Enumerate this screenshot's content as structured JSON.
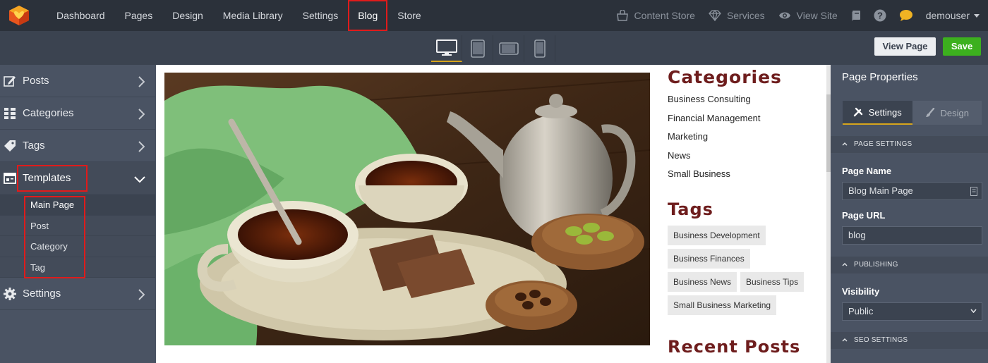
{
  "nav": {
    "items": [
      "Dashboard",
      "Pages",
      "Design",
      "Media Library",
      "Settings",
      "Blog",
      "Store"
    ],
    "active": "Blog",
    "right": {
      "content_store": "Content Store",
      "services": "Services",
      "view_site": "View Site",
      "user": "demouser"
    }
  },
  "toolbar": {
    "devices": [
      "desktop-icon",
      "tablet-icon",
      "tablet-landscape-icon",
      "phone-icon"
    ],
    "active_device": "desktop-icon",
    "view_page": "View Page",
    "save": "Save"
  },
  "sidebar": {
    "items": [
      {
        "label": "Posts",
        "icon": "edit-icon"
      },
      {
        "label": "Categories",
        "icon": "grid-icon"
      },
      {
        "label": "Tags",
        "icon": "tag-icon"
      },
      {
        "label": "Templates",
        "icon": "template-icon"
      },
      {
        "label": "Settings",
        "icon": "gear-icon"
      }
    ],
    "templates_sub": [
      "Main Page",
      "Post",
      "Category",
      "Tag"
    ],
    "active_sub": "Main Page"
  },
  "preview": {
    "categories_title": "Categories",
    "categories": [
      "Business Consulting",
      "Financial Management",
      "Marketing",
      "News",
      "Small Business"
    ],
    "tags_title": "Tags",
    "tags": [
      "Business Development",
      "Business Finances",
      "Business News",
      "Business Tips",
      "Small Business Marketing"
    ],
    "recent_title": "Recent Posts"
  },
  "properties": {
    "title": "Page Properties",
    "tabs": [
      "Settings",
      "Design"
    ],
    "active_tab": "Settings",
    "page_settings": "PAGE SETTINGS",
    "page_name_label": "Page Name",
    "page_name": "Blog Main Page",
    "page_url_label": "Page URL",
    "page_url": "blog",
    "publishing": "PUBLISHING",
    "visibility_label": "Visibility",
    "visibility": "Public",
    "seo_settings": "SEO SETTINGS"
  },
  "colors": {
    "accent_save": "#3cb01e",
    "heading": "#6e1d1d",
    "highlight": "#e01b1b",
    "tab_underline": "#d7a51c"
  }
}
